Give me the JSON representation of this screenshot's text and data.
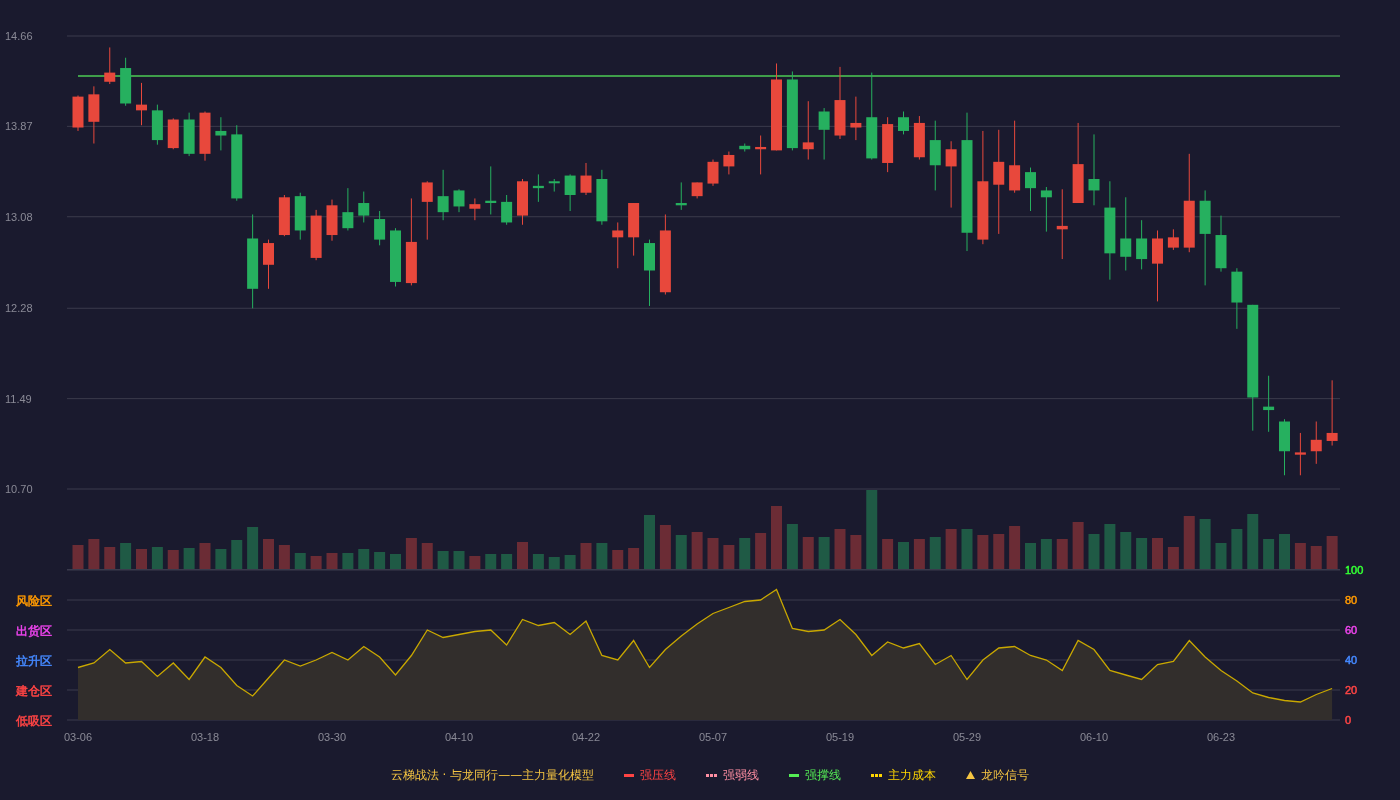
{
  "price_chart": {
    "chart_data": {
      "type": "candlestick",
      "grid": true,
      "ylim": [
        10.7,
        14.66
      ],
      "yticks": [
        {
          "value": 14.66,
          "label": "14.66"
        },
        {
          "value": 13.87,
          "label": "13.87"
        },
        {
          "value": 13.08,
          "label": "13.08"
        },
        {
          "value": 12.28,
          "label": "12.28"
        },
        {
          "value": 11.49,
          "label": "11.49"
        },
        {
          "value": 10.7,
          "label": "10.70"
        }
      ],
      "ohlc": [
        [
          13.86,
          14.14,
          13.83,
          14.13
        ],
        [
          13.91,
          14.22,
          13.72,
          14.15
        ],
        [
          14.26,
          14.56,
          14.24,
          14.34
        ],
        [
          14.38,
          14.47,
          14.05,
          14.07
        ],
        [
          14.01,
          14.25,
          13.88,
          14.06
        ],
        [
          14.01,
          14.06,
          13.71,
          13.75
        ],
        [
          13.68,
          13.94,
          13.67,
          13.93
        ],
        [
          13.93,
          13.99,
          13.61,
          13.63
        ],
        [
          13.63,
          14.0,
          13.57,
          13.99
        ],
        [
          13.83,
          13.95,
          13.66,
          13.79
        ],
        [
          13.8,
          13.88,
          13.22,
          13.24
        ],
        [
          12.89,
          13.1,
          12.28,
          12.45
        ],
        [
          12.66,
          12.88,
          12.45,
          12.85
        ],
        [
          12.92,
          13.27,
          12.91,
          13.25
        ],
        [
          13.26,
          13.29,
          12.88,
          12.96
        ],
        [
          12.72,
          13.14,
          12.7,
          13.09
        ],
        [
          12.92,
          13.23,
          12.87,
          13.18
        ],
        [
          13.12,
          13.33,
          12.96,
          12.98
        ],
        [
          13.2,
          13.3,
          13.03,
          13.09
        ],
        [
          13.06,
          13.13,
          12.83,
          12.88
        ],
        [
          12.96,
          12.98,
          12.47,
          12.51
        ],
        [
          12.5,
          13.24,
          12.48,
          12.86
        ],
        [
          13.21,
          13.39,
          12.88,
          13.38
        ],
        [
          13.26,
          13.49,
          13.05,
          13.12
        ],
        [
          13.31,
          13.32,
          13.12,
          13.17
        ],
        [
          13.15,
          13.24,
          13.05,
          13.19
        ],
        [
          13.22,
          13.52,
          13.1,
          13.2
        ],
        [
          13.21,
          13.27,
          13.01,
          13.03
        ],
        [
          13.09,
          13.41,
          13.01,
          13.39
        ],
        [
          13.35,
          13.45,
          13.21,
          13.33
        ],
        [
          13.39,
          13.41,
          13.3,
          13.38
        ],
        [
          13.44,
          13.45,
          13.13,
          13.27
        ],
        [
          13.29,
          13.55,
          13.27,
          13.44
        ],
        [
          13.41,
          13.49,
          13.01,
          13.04
        ],
        [
          12.9,
          13.03,
          12.63,
          12.96
        ],
        [
          12.9,
          13.2,
          12.74,
          13.2
        ],
        [
          12.85,
          12.88,
          12.3,
          12.61
        ],
        [
          12.42,
          13.1,
          12.4,
          12.96
        ],
        [
          13.2,
          13.38,
          13.14,
          13.18
        ],
        [
          13.26,
          13.38,
          13.24,
          13.38
        ],
        [
          13.37,
          13.58,
          13.35,
          13.56
        ],
        [
          13.52,
          13.65,
          13.45,
          13.62
        ],
        [
          13.7,
          13.72,
          13.65,
          13.67
        ],
        [
          13.67,
          13.79,
          13.45,
          13.69
        ],
        [
          13.66,
          14.42,
          13.66,
          14.28
        ],
        [
          14.28,
          14.35,
          13.66,
          13.68
        ],
        [
          13.67,
          14.09,
          13.58,
          13.73
        ],
        [
          14.0,
          14.03,
          13.58,
          13.84
        ],
        [
          13.79,
          14.39,
          13.76,
          14.1
        ],
        [
          13.86,
          14.13,
          13.75,
          13.9
        ],
        [
          13.95,
          14.34,
          13.58,
          13.59
        ],
        [
          13.55,
          13.95,
          13.47,
          13.89
        ],
        [
          13.95,
          14.0,
          13.8,
          13.83
        ],
        [
          13.6,
          13.96,
          13.58,
          13.9
        ],
        [
          13.75,
          13.92,
          13.31,
          13.53
        ],
        [
          13.52,
          13.74,
          13.16,
          13.67
        ],
        [
          13.75,
          13.99,
          12.78,
          12.94
        ],
        [
          12.88,
          13.83,
          12.84,
          13.39
        ],
        [
          13.36,
          13.84,
          12.93,
          13.56
        ],
        [
          13.31,
          13.92,
          13.29,
          13.53
        ],
        [
          13.47,
          13.51,
          13.13,
          13.33
        ],
        [
          13.31,
          13.34,
          12.95,
          13.25
        ],
        [
          12.97,
          13.32,
          12.71,
          13.0
        ],
        [
          13.2,
          13.9,
          13.2,
          13.54
        ],
        [
          13.41,
          13.8,
          13.18,
          13.31
        ],
        [
          13.16,
          13.39,
          12.53,
          12.76
        ],
        [
          12.89,
          13.25,
          12.61,
          12.73
        ],
        [
          12.89,
          13.05,
          12.62,
          12.71
        ],
        [
          12.67,
          12.96,
          12.34,
          12.89
        ],
        [
          12.81,
          12.97,
          12.79,
          12.9
        ],
        [
          12.81,
          13.63,
          12.77,
          13.22
        ],
        [
          13.22,
          13.31,
          12.48,
          12.93
        ],
        [
          12.92,
          13.09,
          12.6,
          12.63
        ],
        [
          12.6,
          12.63,
          12.1,
          12.33
        ],
        [
          12.31,
          12.31,
          11.21,
          11.5
        ],
        [
          11.42,
          11.69,
          11.2,
          11.39
        ],
        [
          11.29,
          11.31,
          10.82,
          11.03
        ],
        [
          11.0,
          11.19,
          10.82,
          11.02
        ],
        [
          11.03,
          11.29,
          10.92,
          11.13
        ],
        [
          11.12,
          11.65,
          11.08,
          11.19
        ]
      ],
      "ref_lines": [
        {
          "axis": "y",
          "value": 14.31
        }
      ]
    }
  },
  "indicator": {
    "zones": [
      {
        "label": "风险区",
        "color": "#ff9900"
      },
      {
        "label": "出货区",
        "color": "#ee44ee"
      },
      {
        "label": "拉升区",
        "color": "#4488ff"
      },
      {
        "label": "建仓区",
        "color": "#ff4444"
      },
      {
        "label": "低吸区",
        "color": "#ff4444"
      }
    ],
    "axis_labels": [
      {
        "text": "100",
        "color": "#33ff33"
      },
      {
        "text": "80",
        "color": "#ff9900"
      },
      {
        "text": "60",
        "color": "#ee44ee"
      },
      {
        "text": "40",
        "color": "#4488ff"
      },
      {
        "text": "20",
        "color": "#ff4444"
      },
      {
        "text": "0",
        "color": "#ff4444"
      }
    ],
    "chart_data": {
      "type": "area",
      "grid": true,
      "ylim": [
        0,
        100
      ],
      "yticks": [
        100,
        80,
        60,
        40,
        20,
        0
      ],
      "categories": [
        "03-06",
        null,
        null,
        null,
        null,
        null,
        null,
        null,
        "03-18",
        null,
        null,
        null,
        null,
        null,
        null,
        null,
        "03-30",
        null,
        null,
        null,
        null,
        null,
        null,
        null,
        "04-10",
        null,
        null,
        null,
        null,
        null,
        null,
        null,
        "04-22",
        null,
        null,
        null,
        null,
        null,
        null,
        null,
        "05-07",
        null,
        null,
        null,
        null,
        null,
        null,
        null,
        "05-19",
        null,
        null,
        null,
        null,
        null,
        null,
        null,
        "05-29",
        null,
        null,
        null,
        null,
        null,
        null,
        null,
        "06-10",
        null,
        null,
        null,
        null,
        null,
        null,
        null,
        "06-23",
        null,
        null,
        null,
        null,
        null,
        null,
        null
      ],
      "values": [
        35,
        38,
        47,
        38,
        39,
        29,
        38,
        27,
        42,
        35,
        23,
        16,
        28,
        40,
        36,
        40,
        45,
        40,
        49,
        42,
        30,
        43,
        60,
        55,
        57,
        59,
        60,
        50,
        67,
        63,
        65,
        57,
        66,
        43,
        40,
        53,
        35,
        47,
        56,
        64,
        71,
        75,
        79,
        80,
        87,
        61,
        59,
        60,
        67,
        57,
        43,
        52,
        48,
        51,
        37,
        43,
        27,
        40,
        48,
        49,
        43,
        40,
        33,
        53,
        47,
        33,
        30,
        27,
        37,
        39,
        53,
        42,
        33,
        26,
        18,
        15,
        13,
        12,
        17,
        21
      ]
    }
  },
  "legend": {
    "title": "云梯战法 · 与龙同行——主力量化模型",
    "items": [
      {
        "kind": "solid",
        "label": "强压线",
        "color": "#ff4444"
      },
      {
        "kind": "dashed",
        "label": "强弱线",
        "color": "#ff8fa3"
      },
      {
        "kind": "solid",
        "label": "强撑线",
        "color": "#55ee55"
      },
      {
        "kind": "dashed",
        "label": "主力成本",
        "color": "#ffd700"
      },
      {
        "kind": "triangle",
        "label": "龙吟信号",
        "color": "#f5c542"
      }
    ]
  }
}
